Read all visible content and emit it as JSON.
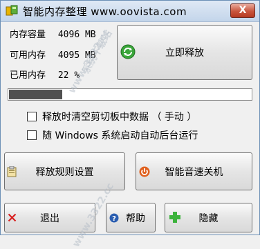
{
  "window": {
    "title": "智能内存整理 www.oovista.com",
    "close_label": "X"
  },
  "memory": {
    "capacity_label": "内存容量",
    "capacity_value": "4096 MB",
    "available_label": "可用内存",
    "available_value": "4095 MB",
    "used_label": "已用内存",
    "used_value": "22 %"
  },
  "buttons": {
    "release_now": "立即释放",
    "release_rules": "释放规则设置",
    "smart_shutdown": "智能音速关机",
    "exit": "退出",
    "help": "帮助",
    "hide": "隐藏"
  },
  "progress": {
    "percent": 22
  },
  "options": {
    "clear_clipboard": "释放时清空剪切板中数据 （ 手动 ）",
    "autostart": "随 Windows 系统启动自动后台运行"
  },
  "watermark": {
    "text1": "www.3322.cc",
    "text2": "系统下载站",
    "text3": "www.3322.cc"
  },
  "icons": {
    "app": "memory-chip-icon",
    "release": "refresh-arrows-icon",
    "rules": "clipboard-icon",
    "shutdown": "power-icon",
    "exit": "red-x-icon",
    "help": "question-icon",
    "hide": "green-plus-icon"
  },
  "colors": {
    "title_gradient_top": "#dfe9f5",
    "close_button": "#c8553d",
    "progress_fill": "#505050",
    "refresh_icon": "#3aa63a",
    "power_icon": "#e0601e",
    "help_icon": "#2a5db0",
    "hide_icon": "#3bb23b",
    "exit_icon": "#d82020"
  }
}
